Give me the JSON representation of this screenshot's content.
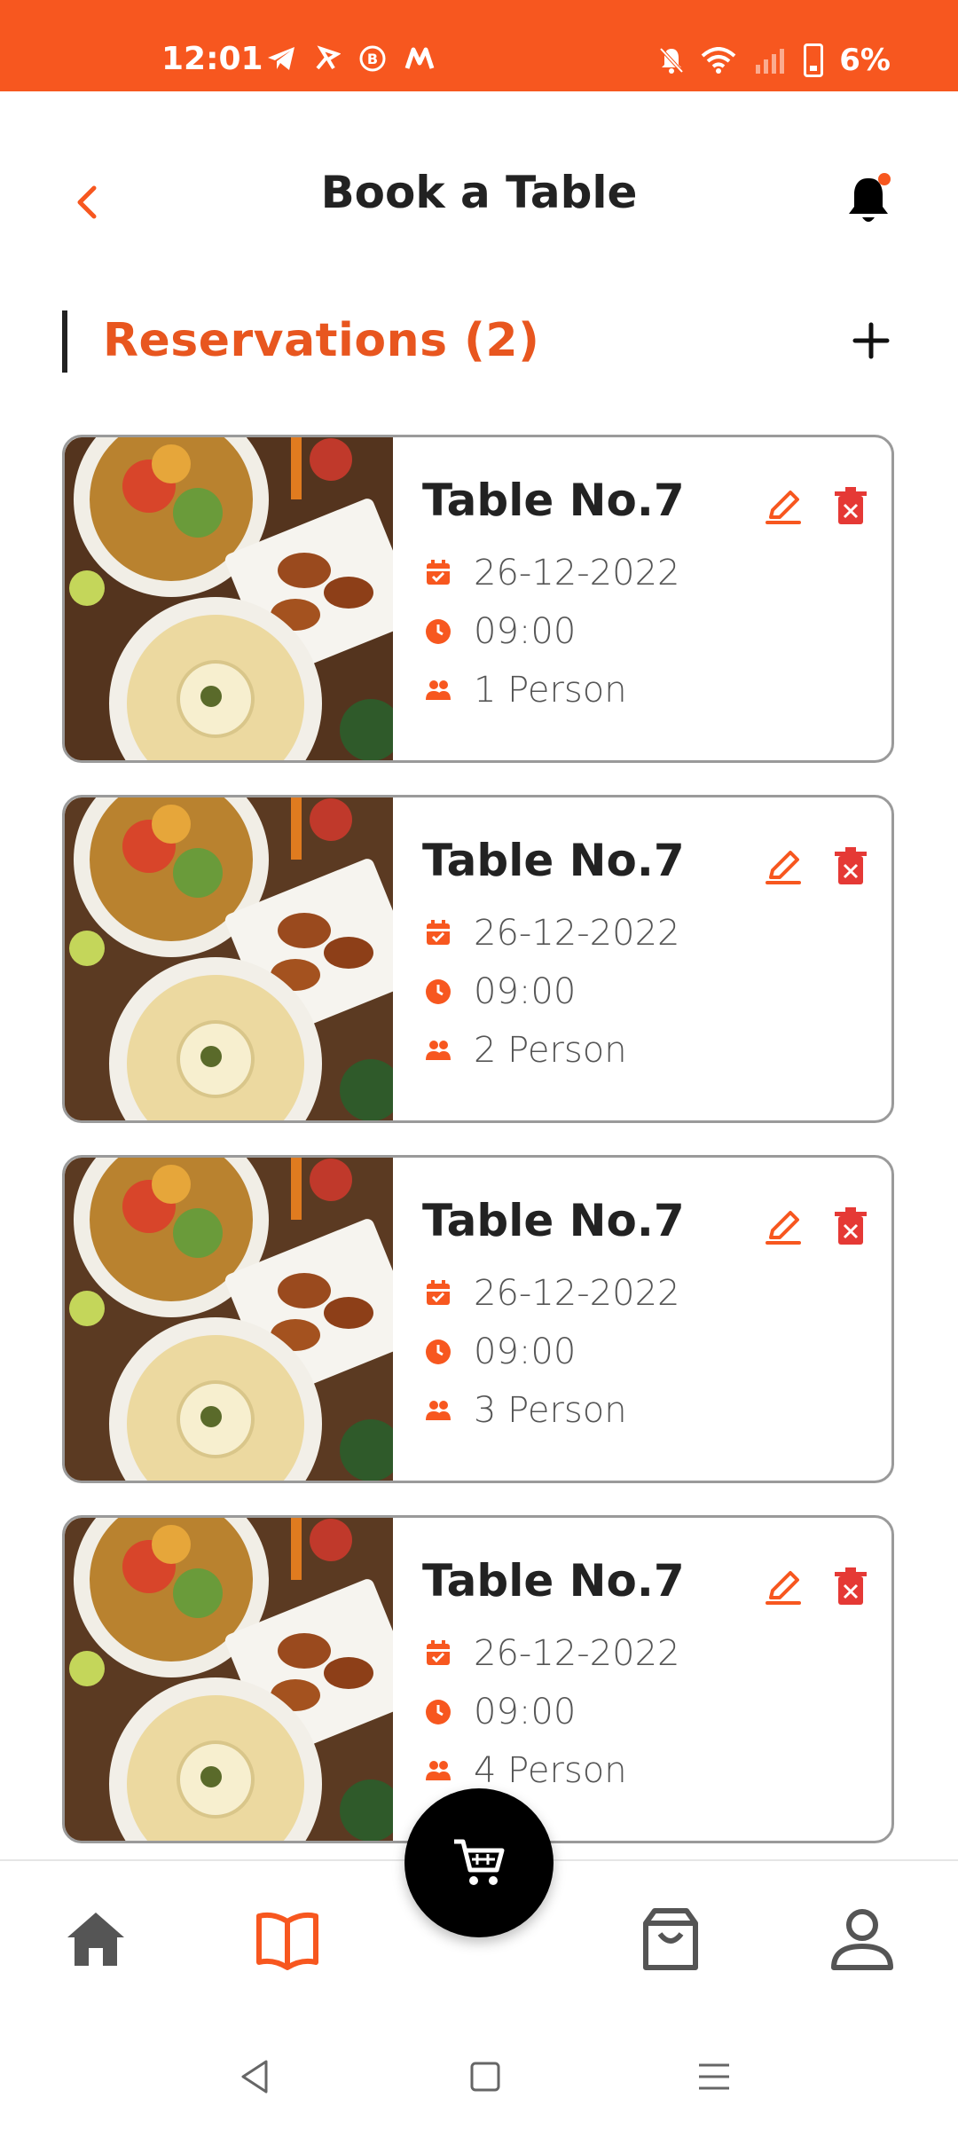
{
  "status_bar": {
    "time": "12:01",
    "battery_percent": "6%",
    "left_icons": [
      "telegram-icon",
      "sync-icon",
      "b-icon",
      "m-icon"
    ],
    "right_icons": [
      "bell-off-icon",
      "wifi-icon",
      "signal-icon",
      "battery-charging-icon"
    ]
  },
  "header": {
    "title": "Book a Table",
    "back_icon": "chevron-left-icon",
    "notification_icon": "bell-icon"
  },
  "section": {
    "title": "Reservations",
    "count": "(2)",
    "add_icon": "plus-icon"
  },
  "reservations": [
    {
      "table": "Table No.7",
      "date": "26-12-2022",
      "time": "09:00",
      "persons": "1 Person"
    },
    {
      "table": "Table No.7",
      "date": "26-12-2022",
      "time": "09:00",
      "persons": "2 Person"
    },
    {
      "table": "Table No.7",
      "date": "26-12-2022",
      "time": "09:00",
      "persons": "3 Person"
    },
    {
      "table": "Table No.7",
      "date": "26-12-2022",
      "time": "09:00",
      "persons": "4 Person"
    }
  ],
  "bottom_nav": {
    "items": [
      "home-icon",
      "book-icon",
      "cart-icon",
      "bag-icon",
      "profile-icon"
    ],
    "active": "book-icon"
  },
  "colors": {
    "accent": "#f7571f",
    "accent_text": "#e8561f",
    "delete": "#e53935",
    "text_dark": "#222222"
  }
}
